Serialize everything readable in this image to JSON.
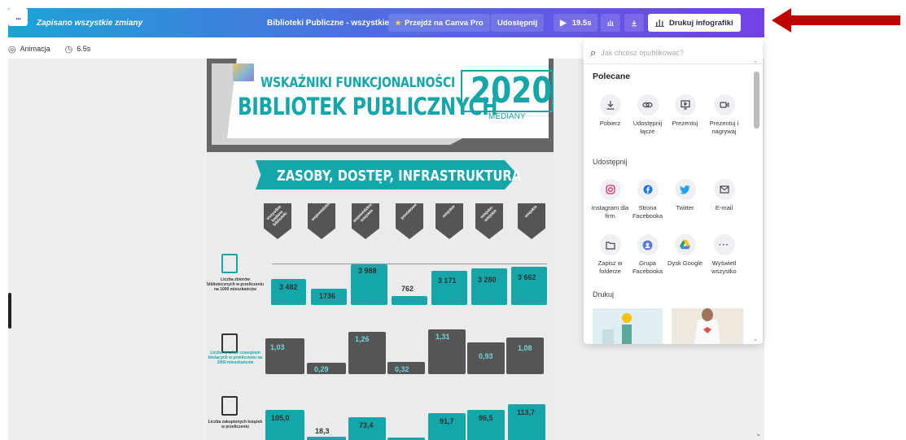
{
  "topbar": {
    "saved_text": "Zapisano wszystkie zmiany",
    "title": "Biblioteki Publiczne - wszystkie",
    "pro_label": "Przejdź na Canva Pro",
    "share_label": "Udostępnij",
    "play_label": "19.5s",
    "print_label": "Drukuj infografiki",
    "more_label": "..."
  },
  "toolbar": {
    "animation_label": "Animacja",
    "duration_label": "6.5s"
  },
  "panel": {
    "search_placeholder": "Jak chcesz opublikować?",
    "section_recommended": "Polecane",
    "recommended": [
      {
        "icon": "download-icon",
        "label": "Pobierz"
      },
      {
        "icon": "link-icon",
        "label": "Udostępnij łącze"
      },
      {
        "icon": "present-icon",
        "label": "Prezentuj"
      },
      {
        "icon": "record-icon",
        "label": "Prezentuj i nagrywaj"
      }
    ],
    "section_share": "Udostępnij",
    "share": [
      {
        "icon": "instagram-icon",
        "label": "Instagram dla firm",
        "color": "#e1306c"
      },
      {
        "icon": "facebook-icon",
        "label": "Strona Facebooka",
        "color": "#1877f2"
      },
      {
        "icon": "twitter-icon",
        "label": "Twitter",
        "color": "#1da1f2"
      },
      {
        "icon": "email-icon",
        "label": "E-mail",
        "color": "#444444"
      },
      {
        "icon": "folder-icon",
        "label": "Zapisz w folderze",
        "color": "#444444"
      },
      {
        "icon": "facebook-group-icon",
        "label": "Grupa Facebooka",
        "color": "#5b7bd5"
      },
      {
        "icon": "google-drive-icon",
        "label": "Dysk Google",
        "color": "#1fa463"
      },
      {
        "icon": "more-icon",
        "label": "Wyświetl wszystko",
        "color": "#444444"
      }
    ],
    "section_print": "Drukuj"
  },
  "infographic": {
    "heading_line1": "WSKAŹNIKI FUNKCJONALNOŚCI",
    "heading_line2": "BIBLIOTEK PUBLICZNYCH",
    "year": "2020",
    "year_sub": "MEDIANY",
    "banner": "ZASOBY, DOSTĘP, INFRASTRUKTURA",
    "categories": [
      "wszystkie badane biblioteki",
      "wojewódzkie",
      "wojewódzkie i miejskie",
      "powiatowe",
      "miejskie",
      "miejsko-wiejskie",
      "wiejskie"
    ],
    "rows": [
      {
        "label": "Liczba zbiorów bibliotecznych w przeliczeniu na 1000 mieszkańców",
        "values": [
          "3 482",
          "1736",
          "3 988",
          "762",
          "3 171",
          "3 280",
          "3 662"
        ]
      },
      {
        "label": "Liczba tytułów czasopism bieżących w przeliczeniu na 1000 mieszkańców",
        "values": [
          "1,03",
          "0,29",
          "1,26",
          "0,32",
          "1,31",
          "0,93",
          "1,08"
        ]
      },
      {
        "label": "Liczba zakupionych książek w przeliczeniu",
        "values": [
          "105,0",
          "18,3",
          "73,4",
          "",
          "91,7",
          "96,5",
          "113,7"
        ]
      }
    ]
  },
  "colors": {
    "accent": "#14a6a8",
    "dark": "#555555",
    "arrow": "#c00000"
  }
}
